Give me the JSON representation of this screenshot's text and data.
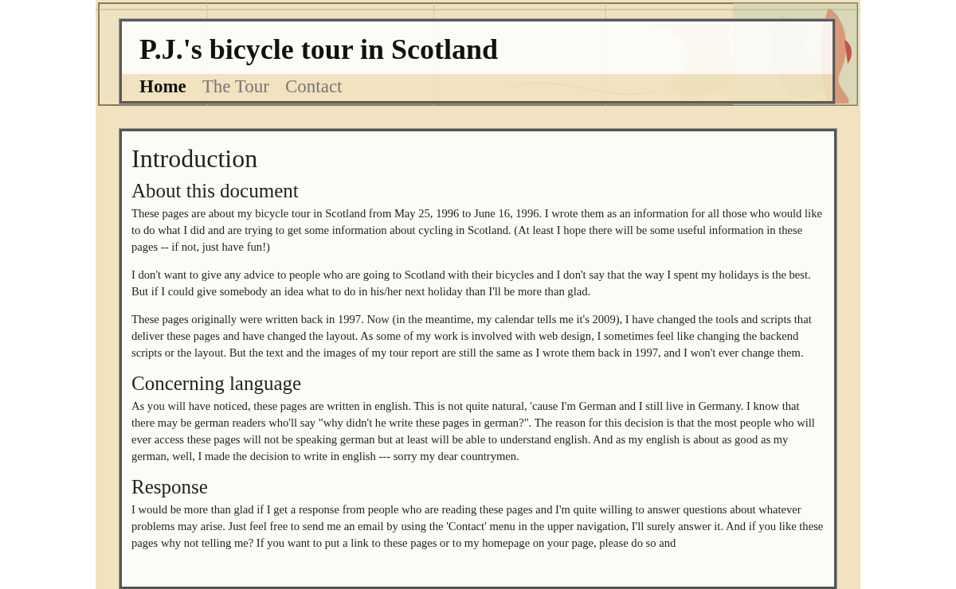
{
  "site_title": "P.J.'s bicycle tour in Scotland",
  "nav": [
    {
      "label": "Home",
      "selected": true
    },
    {
      "label": "The Tour",
      "selected": false
    },
    {
      "label": "Contact",
      "selected": false
    }
  ],
  "content": {
    "title": "Introduction",
    "sections": [
      {
        "heading": "About this document",
        "paragraphs": [
          "These pages are about my bicycle tour in Scotland from May 25, 1996 to June 16, 1996. I wrote them as an information for all those who would like to do what I did and are trying to get some information about cycling in Scotland. (At least I hope there will be some useful information in these pages -- if not, just have fun!)",
          "I don't want to give any advice to people who are going to Scotland with their bicycles and I don't say that the way I spent my holidays is the best. But if I could give somebody an idea what to do in his/her next holiday than I'll be more than glad.",
          "These pages originally were written back in 1997. Now (in the meantime, my calendar tells me it's 2009), I have changed the tools and scripts that deliver these pages and have changed the layout. As some of my work is involved with web design, I sometimes feel like changing the backend scripts or the layout. But the text and the images of my tour report are still the same as I wrote them back in 1997, and I won't ever change them."
        ]
      },
      {
        "heading": "Concerning language",
        "paragraphs": [
          "As you will have noticed, these pages are written in english. This is not quite natural, 'cause I'm German and I still live in Germany. I know that there may be german readers who'll say \"why didn't he write these pages in german?\". The reason for this decision is that the most people who will ever access these pages will not be speaking german but at least will be able to understand english. And as my english is about as good as my german, well, I made the decision to write in english --- sorry my dear countrymen."
        ]
      },
      {
        "heading": "Response",
        "paragraphs": [
          "I would be more than glad if I get a response from people who are reading these pages and I'm quite willing to answer questions about whatever problems may arise. Just feel free to send me an email by using the 'Contact' menu in the upper navigation, I'll surely answer it. And if you like these pages why not telling me? If you want to put a link to these pages or to my homepage on your page, please do so and"
        ]
      }
    ]
  }
}
